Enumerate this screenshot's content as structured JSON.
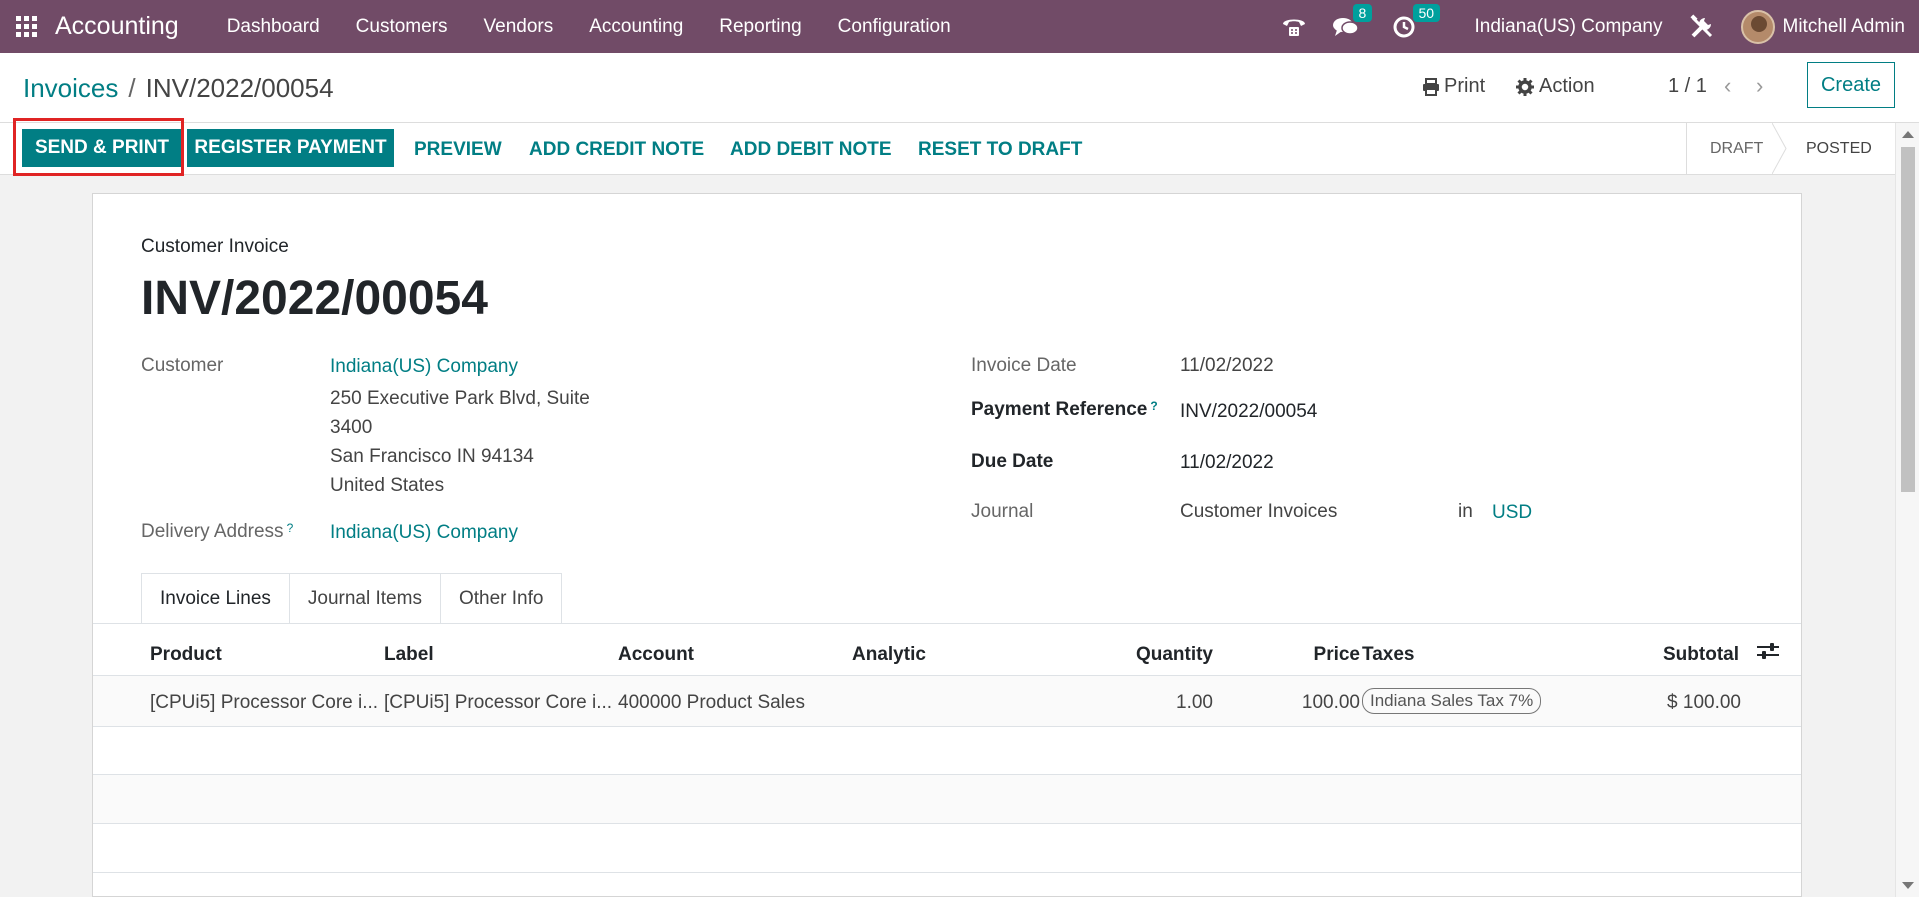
{
  "navbar": {
    "app_name": "Accounting",
    "menu": [
      "Dashboard",
      "Customers",
      "Vendors",
      "Accounting",
      "Reporting",
      "Configuration"
    ],
    "messages_count": "8",
    "activities_count": "50",
    "company": "Indiana(US) Company",
    "user": "Mitchell Admin",
    "brand_color": "#714b67"
  },
  "breadcrumb": {
    "parent": "Invoices",
    "separator": "/",
    "current": "INV/2022/00054"
  },
  "control": {
    "print_label": "Print",
    "action_label": "Action",
    "pager": "1 / 1",
    "create_label": "Create"
  },
  "actions": {
    "send_print": "SEND & PRINT",
    "register_payment": "REGISTER PAYMENT",
    "preview": "PREVIEW",
    "add_credit_note": "ADD CREDIT NOTE",
    "add_debit_note": "ADD DEBIT NOTE",
    "reset_to_draft": "RESET TO DRAFT"
  },
  "statusbar": {
    "draft": "DRAFT",
    "posted": "POSTED",
    "current": "POSTED"
  },
  "invoice": {
    "type": "Customer Invoice",
    "number": "INV/2022/00054",
    "customer_label": "Customer",
    "customer": "Indiana(US) Company",
    "address_line1": "250 Executive Park Blvd, Suite",
    "address_line2": "3400",
    "address_line3": "San Francisco IN 94134",
    "address_line4": "United States",
    "delivery_label": "Delivery Address",
    "delivery": "Indiana(US) Company",
    "invoice_date_label": "Invoice Date",
    "invoice_date": "11/02/2022",
    "payment_ref_label": "Payment Reference",
    "payment_ref": "INV/2022/00054",
    "due_date_label": "Due Date",
    "due_date": "11/02/2022",
    "journal_label": "Journal",
    "journal": "Customer Invoices",
    "in_label": "in",
    "currency": "USD",
    "help_mark": "?"
  },
  "tabs": [
    "Invoice Lines",
    "Journal Items",
    "Other Info"
  ],
  "table": {
    "headers": {
      "product": "Product",
      "label": "Label",
      "account": "Account",
      "analytic": "Analytic",
      "quantity": "Quantity",
      "price": "Price",
      "taxes": "Taxes",
      "subtotal": "Subtotal"
    },
    "rows": [
      {
        "product": "[CPUi5] Processor Core i...",
        "label": "[CPUi5] Processor Core i...",
        "account": "400000 Product Sales",
        "analytic": "",
        "quantity": "1.00",
        "price": "100.00",
        "tax": "Indiana Sales Tax 7%",
        "subtotal": "$ 100.00"
      }
    ]
  }
}
